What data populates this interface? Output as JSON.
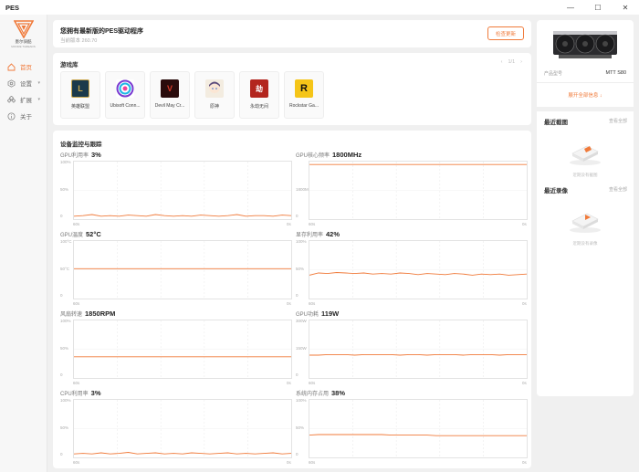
{
  "app": {
    "title": "PES"
  },
  "window_controls": {
    "minimize": "—",
    "maximize": "☐",
    "close": "✕"
  },
  "logo": {
    "name": "墨尔骑酷",
    "sub": "MOORE THREADS"
  },
  "sidebar": {
    "items": [
      {
        "label": "首页",
        "icon": "home-icon",
        "active": true
      },
      {
        "label": "设置",
        "icon": "settings-icon",
        "caret": "▾"
      },
      {
        "label": "扩展",
        "icon": "extension-icon",
        "caret": "▾"
      },
      {
        "label": "关于",
        "icon": "info-icon"
      }
    ]
  },
  "update": {
    "title": "您拥有最新版的PES驱动程序",
    "version": "当前版本 260.70",
    "check_button": "检查更新"
  },
  "games": {
    "title": "游戏库",
    "pager": {
      "prev": "‹",
      "page": "1/1",
      "next": "›"
    },
    "items": [
      {
        "name": "英雄联盟",
        "icon": "lol-icon",
        "color": "#1b3a4b",
        "glyph": "L"
      },
      {
        "name": "Ubisoft Conn...",
        "icon": "ubisoft-icon",
        "color": "#ffffff",
        "glyph": ""
      },
      {
        "name": "Devil May Cr...",
        "icon": "dmc-icon",
        "color": "#2a0c0c",
        "glyph": "V"
      },
      {
        "name": "原神",
        "icon": "genshin-icon",
        "color": "#f3ece0",
        "glyph": ""
      },
      {
        "name": "永劫无间",
        "icon": "naraka-icon",
        "color": "#b3261e",
        "glyph": "劫"
      },
      {
        "name": "Rockstar Ga...",
        "icon": "rockstar-icon",
        "color": "#f5c518",
        "glyph": "R"
      }
    ]
  },
  "monitor": {
    "title": "设备监控与跟踪",
    "x_start": "60s",
    "x_end": "0s",
    "accent": "#f07a3a",
    "charts": [
      {
        "label": "GPU利用率",
        "value": "3%",
        "yticks": [
          "100%",
          "50%",
          "0"
        ],
        "data": [
          0.02,
          0.03,
          0.05,
          0.02,
          0.03,
          0.02,
          0.04,
          0.03,
          0.02,
          0.05,
          0.03,
          0.02,
          0.03,
          0.02,
          0.04,
          0.03,
          0.02,
          0.03,
          0.05,
          0.02,
          0.03,
          0.03,
          0.02,
          0.04,
          0.03
        ]
      },
      {
        "label": "GPU核心频率",
        "value": "1800MHz",
        "yticks": [
          "",
          "1800MHz",
          "0"
        ],
        "data": [
          0.98,
          0.98,
          0.98,
          0.98,
          0.98,
          0.98,
          0.98,
          0.98,
          0.98,
          0.98,
          0.98,
          0.98,
          0.98,
          0.98,
          0.98,
          0.98,
          0.98,
          0.98,
          0.98,
          0.98,
          0.98,
          0.98,
          0.98,
          0.98,
          0.98
        ]
      },
      {
        "label": "GPU温度",
        "value": "52°C",
        "yticks": [
          "100°C",
          "50°C",
          "0"
        ],
        "data": [
          0.52,
          0.52,
          0.52,
          0.52,
          0.52,
          0.52,
          0.52,
          0.52,
          0.52,
          0.52,
          0.52,
          0.52,
          0.52,
          0.52,
          0.52,
          0.52,
          0.52,
          0.52,
          0.52,
          0.52,
          0.52,
          0.52,
          0.52,
          0.52,
          0.52
        ]
      },
      {
        "label": "显存利用率",
        "value": "42%",
        "yticks": [
          "100%",
          "50%",
          "0"
        ],
        "data": [
          0.4,
          0.44,
          0.43,
          0.45,
          0.44,
          0.43,
          0.44,
          0.42,
          0.43,
          0.42,
          0.44,
          0.43,
          0.41,
          0.43,
          0.42,
          0.41,
          0.43,
          0.42,
          0.4,
          0.42,
          0.41,
          0.42,
          0.4,
          0.41,
          0.42
        ]
      },
      {
        "label": "风扇转速",
        "value": "1850RPM",
        "yticks": [
          "100%",
          "50%",
          "0"
        ],
        "data": [
          0.36,
          0.36,
          0.36,
          0.36,
          0.36,
          0.36,
          0.36,
          0.36,
          0.36,
          0.36,
          0.36,
          0.36,
          0.36,
          0.36,
          0.36,
          0.36,
          0.36,
          0.36,
          0.36,
          0.36,
          0.36,
          0.36,
          0.36,
          0.36,
          0.36
        ]
      },
      {
        "label": "GPU功耗",
        "value": "119W",
        "yticks": [
          "300W",
          "150W",
          "0"
        ],
        "data": [
          0.39,
          0.39,
          0.4,
          0.4,
          0.4,
          0.39,
          0.4,
          0.4,
          0.4,
          0.4,
          0.39,
          0.4,
          0.4,
          0.39,
          0.4,
          0.4,
          0.4,
          0.39,
          0.4,
          0.4,
          0.4,
          0.39,
          0.4,
          0.4,
          0.4
        ]
      },
      {
        "label": "CPU利用率",
        "value": "3%",
        "yticks": [
          "100%",
          "50%",
          "0"
        ],
        "data": [
          0.03,
          0.04,
          0.03,
          0.05,
          0.03,
          0.04,
          0.06,
          0.03,
          0.04,
          0.05,
          0.03,
          0.04,
          0.03,
          0.05,
          0.04,
          0.03,
          0.04,
          0.05,
          0.03,
          0.04,
          0.03,
          0.04,
          0.05,
          0.03,
          0.04
        ]
      },
      {
        "label": "系统内存占用",
        "value": "38%",
        "yticks": [
          "100%",
          "50%",
          "0"
        ],
        "data": [
          0.38,
          0.39,
          0.39,
          0.39,
          0.39,
          0.39,
          0.39,
          0.39,
          0.39,
          0.38,
          0.38,
          0.38,
          0.38,
          0.38,
          0.37,
          0.37,
          0.37,
          0.37,
          0.37,
          0.37,
          0.37,
          0.37,
          0.37,
          0.37,
          0.37
        ]
      }
    ]
  },
  "device": {
    "model_label": "产品型号",
    "model_value": "MTT S80",
    "expand_link": "展开全部信息 ↓"
  },
  "screenshots": {
    "title": "最近截图",
    "view_all": "查看全部",
    "empty": "近期没有截图"
  },
  "recordings": {
    "title": "最近录像",
    "view_all": "查看全部",
    "empty": "近期没有录像"
  }
}
